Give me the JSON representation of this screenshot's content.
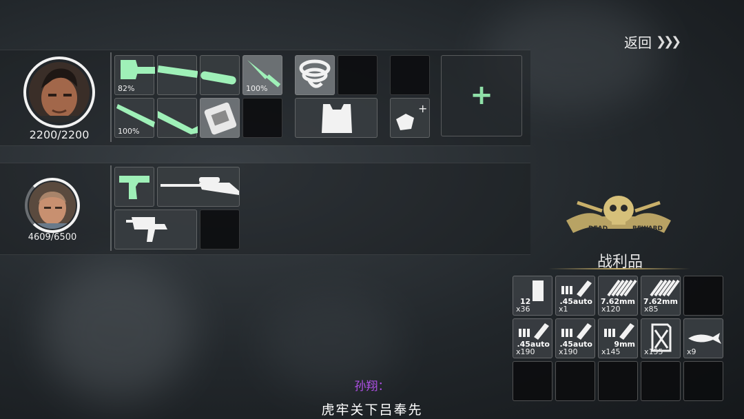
{
  "header": {
    "back_label": "返回",
    "back_chevrons": "❯❯❯"
  },
  "squad": [
    {
      "hp": "2200/2200",
      "hp_fraction": 1.0,
      "slots": [
        {
          "item": "axe",
          "condition": "82%"
        },
        {
          "item": "axe-handle",
          "condition": ""
        },
        {
          "item": "axe-handle-end",
          "condition": ""
        },
        {
          "item": "knife",
          "condition": "100%"
        },
        {
          "item": "rope",
          "condition": ""
        },
        {
          "item": "empty",
          "condition": ""
        },
        {
          "item": "empty",
          "condition": ""
        },
        {
          "item": "baseball-bat",
          "condition": "100%"
        },
        {
          "item": "baseball-bat-end",
          "condition": ""
        },
        {
          "item": "bandage-pack",
          "condition": ""
        },
        {
          "item": "empty",
          "condition": ""
        },
        {
          "item": "body-armor",
          "condition": ""
        },
        {
          "item": "crafting-materials",
          "condition": ""
        }
      ]
    },
    {
      "hp": "4609/6500",
      "hp_fraction": 0.709,
      "slots": [
        {
          "item": "pistol",
          "condition": ""
        },
        {
          "item": "sniper-rifle",
          "condition": ""
        },
        {
          "item": "smg",
          "condition": ""
        },
        {
          "item": "empty",
          "condition": ""
        }
      ]
    }
  ],
  "add_slot_symbol": "+",
  "loot": {
    "title": "战利品",
    "emblem_text_left": "DEAD",
    "emblem_text_right": "REWARD",
    "items": [
      {
        "item": "shotgun-shells",
        "caliber": "12",
        "qty": "x36"
      },
      {
        "item": "ammo",
        "caliber": ".45auto",
        "qty": "x1"
      },
      {
        "item": "rifle-ammo",
        "caliber": "7.62mm",
        "qty": "x120"
      },
      {
        "item": "rifle-ammo",
        "caliber": "7.62mm",
        "qty": "x85"
      },
      {
        "item": "empty",
        "caliber": "",
        "qty": ""
      },
      {
        "item": "ammo",
        "caliber": ".45auto",
        "qty": "x190"
      },
      {
        "item": "ammo",
        "caliber": ".45auto",
        "qty": "x190"
      },
      {
        "item": "ammo",
        "caliber": "9mm",
        "qty": "x145"
      },
      {
        "item": "fuel-can",
        "caliber": "",
        "qty": "x155"
      },
      {
        "item": "fish",
        "caliber": "",
        "qty": "x9"
      },
      {
        "item": "empty",
        "caliber": "",
        "qty": ""
      },
      {
        "item": "empty",
        "caliber": "",
        "qty": ""
      },
      {
        "item": "empty",
        "caliber": "",
        "qty": ""
      },
      {
        "item": "empty",
        "caliber": "",
        "qty": ""
      },
      {
        "item": "empty",
        "caliber": "",
        "qty": ""
      }
    ]
  },
  "subtitle": {
    "speaker": "孙翔：",
    "line": "虎牢关下吕奉先"
  },
  "colors": {
    "weapon_tint": "#9ff0b8",
    "emblem_gold": "#c9b06a",
    "speaker": "#b050e8"
  }
}
